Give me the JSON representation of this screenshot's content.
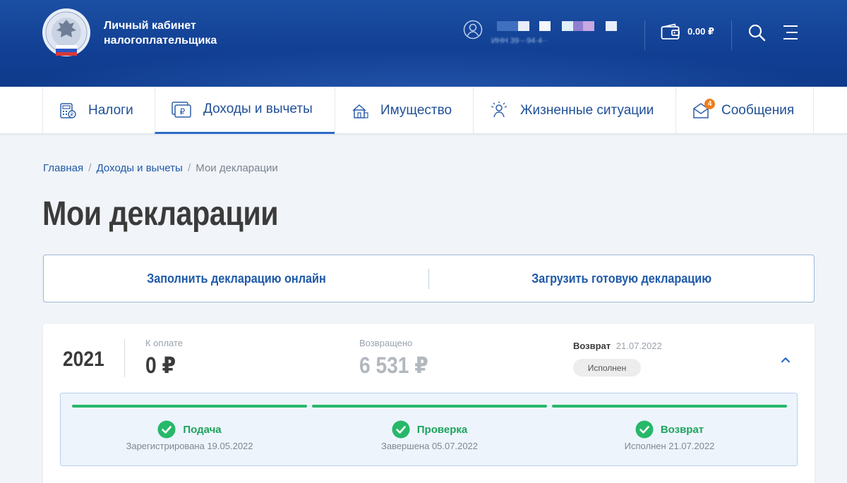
{
  "brand": {
    "line1": "Личный кабинет",
    "line2": "налогоплательщика"
  },
  "user": {
    "inn": "ИНН 39·-·94·4··"
  },
  "wallet": {
    "balance": "0.00 ₽"
  },
  "tabs": [
    {
      "label": "Налоги",
      "icon": "calculator-icon"
    },
    {
      "label": "Доходы и вычеты",
      "icon": "ruble-document-icon",
      "active": true
    },
    {
      "label": "Имущество",
      "icon": "property-icon"
    },
    {
      "label": "Жизненные ситуации",
      "icon": "life-situations-icon"
    },
    {
      "label": "Сообщения",
      "icon": "messages-icon",
      "badge": "4"
    }
  ],
  "breadcrumb": {
    "home": "Главная",
    "section": "Доходы и вычеты",
    "current": "Мои декларации"
  },
  "page": {
    "title": "Мои декларации"
  },
  "actions": {
    "fill_online": "Заполнить декларацию онлайн",
    "upload_ready": "Загрузить готовую декларацию"
  },
  "declaration": {
    "year": "2021",
    "to_pay_label": "К оплате",
    "to_pay_value": "0 ₽",
    "returned_label": "Возвращено",
    "returned_value": "6 531 ₽",
    "refund_label": "Возврат",
    "refund_date": "21.07.2022",
    "status": "Исполнен",
    "steps": [
      {
        "name": "Подача",
        "detail": "Зарегистрирована 19.05.2022"
      },
      {
        "name": "Проверка",
        "detail": "Завершена 05.07.2022"
      },
      {
        "name": "Возврат",
        "detail": "Исполнен 21.07.2022"
      }
    ]
  },
  "colors": {
    "header": "#124094",
    "accent": "#1f5aa8",
    "success": "#27b86a",
    "badge": "#f07d1a"
  }
}
